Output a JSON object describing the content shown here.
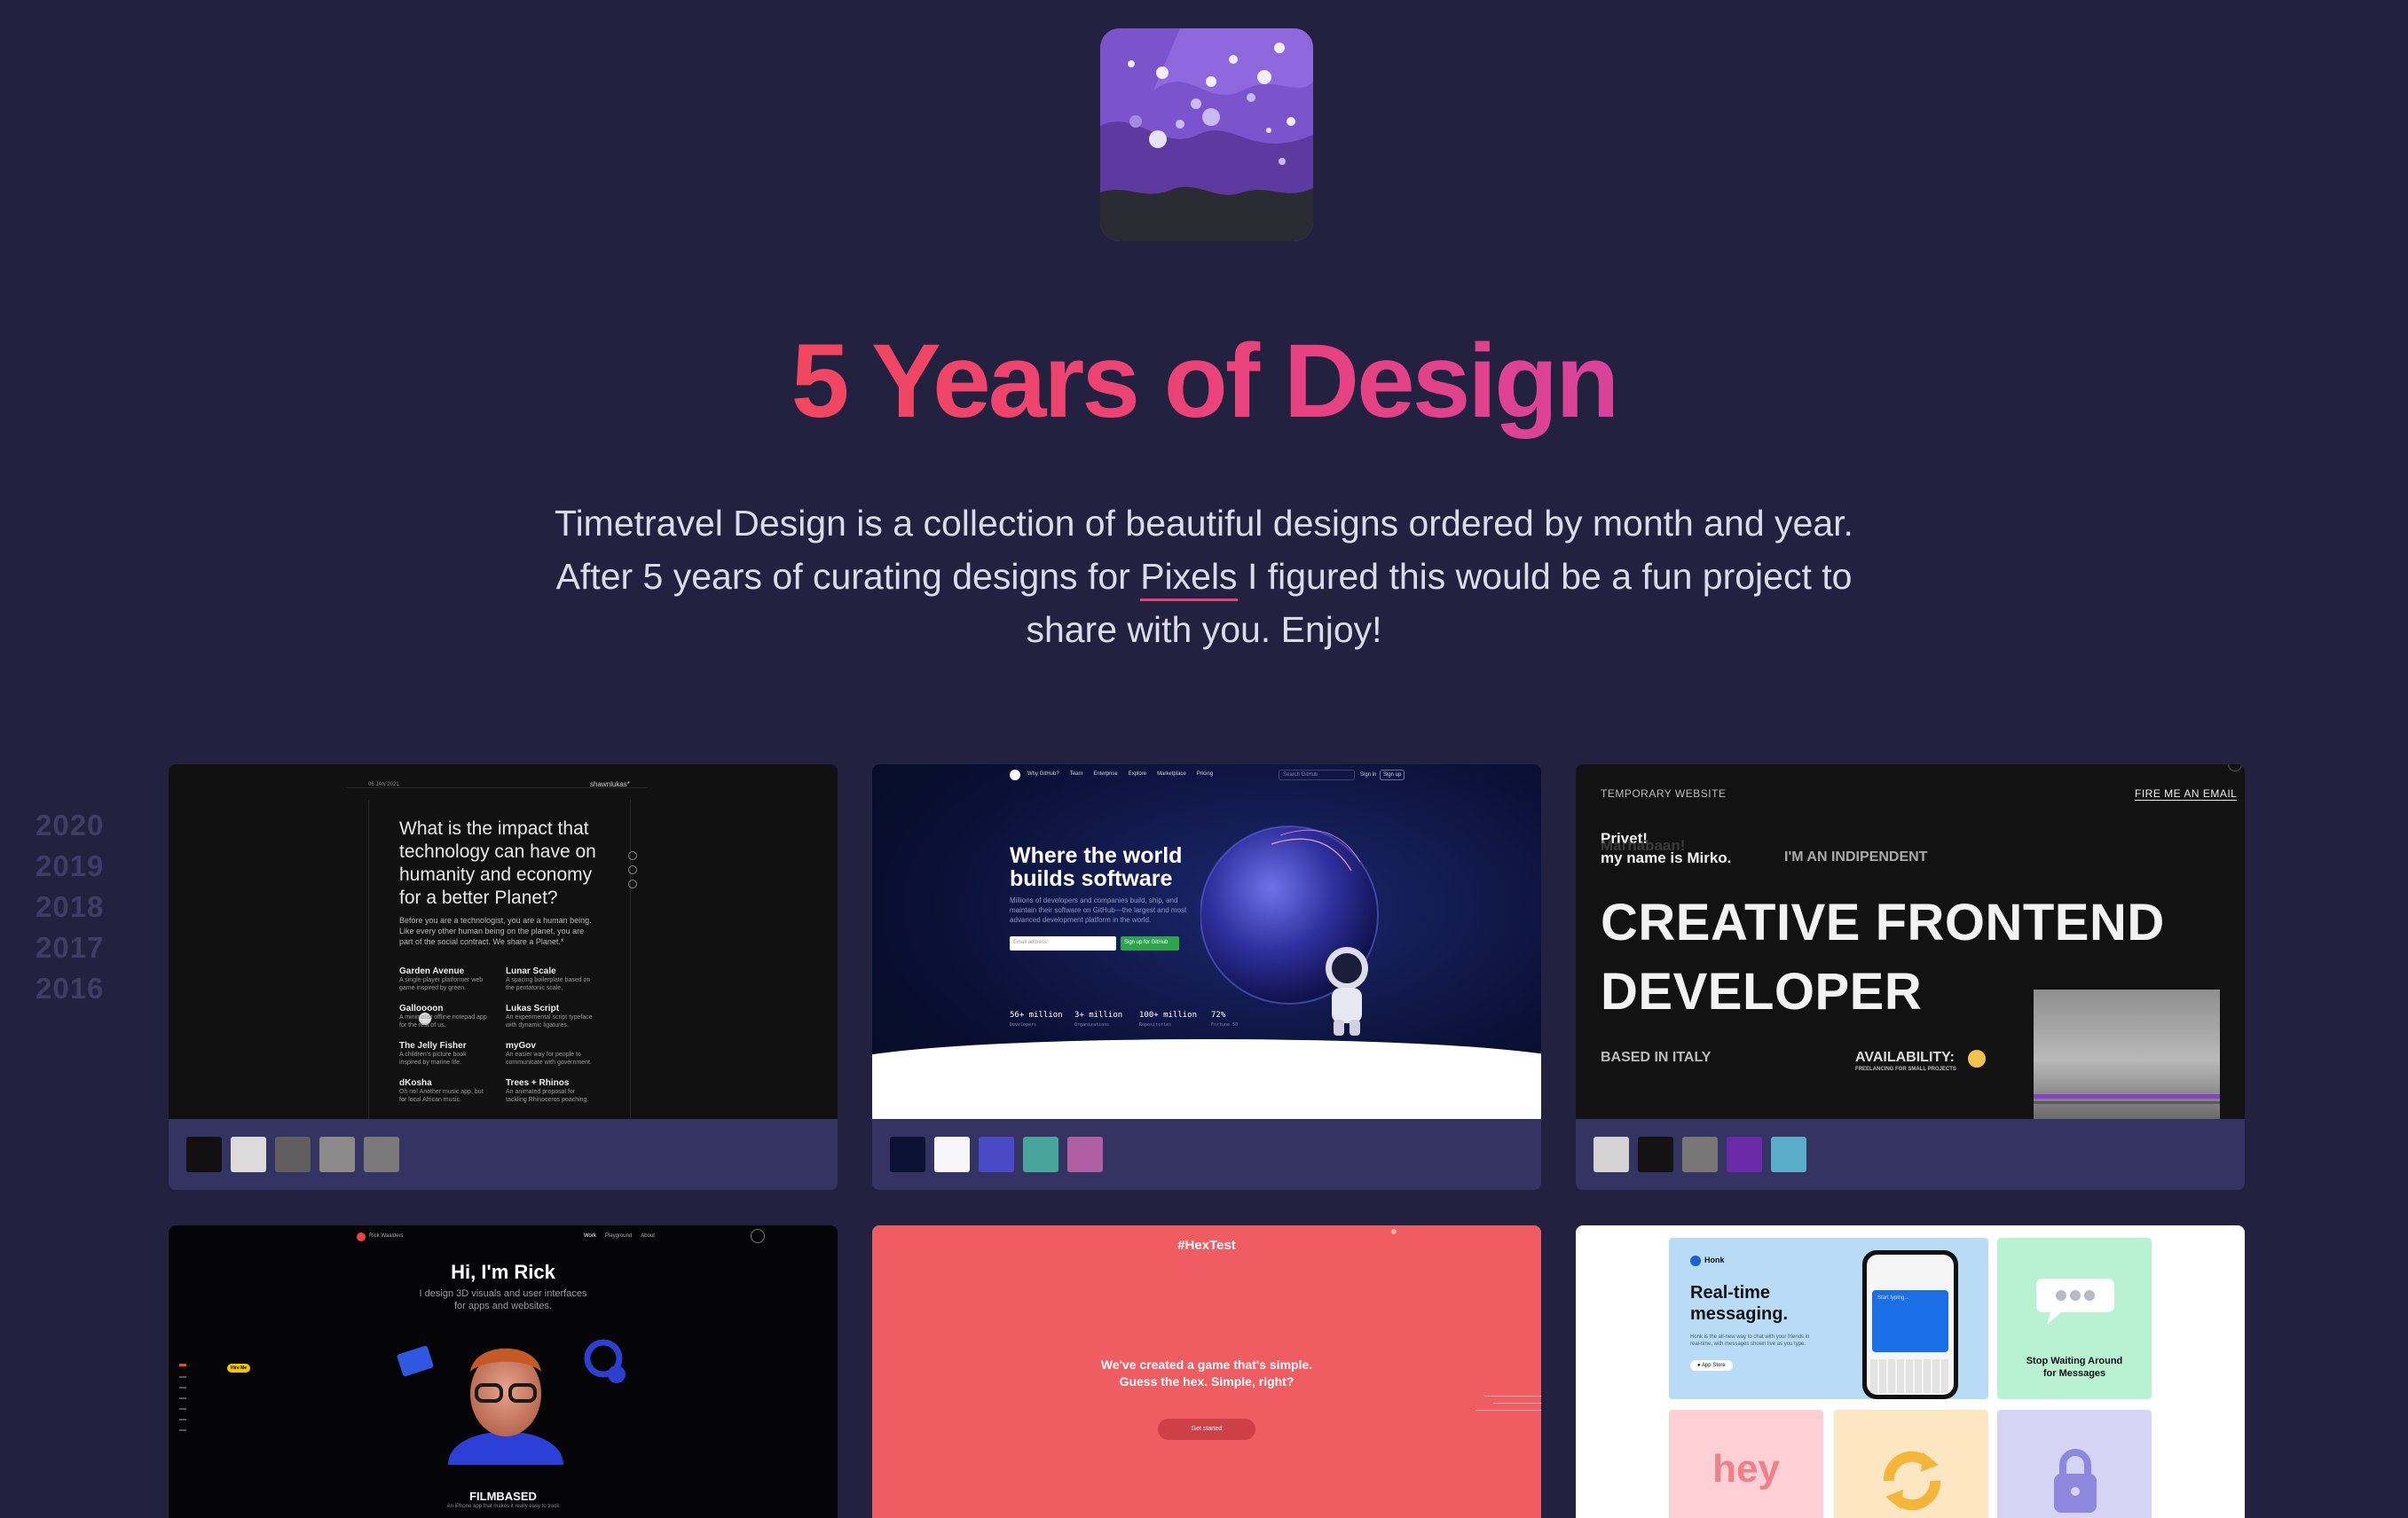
{
  "hero": {
    "title": "5 Years of Design",
    "intro_line1": "Timetravel Design is a collection of beautiful designs ordered by month and year.",
    "intro_line2_before": "After 5 years of curating designs for ",
    "intro_link": "Pixels",
    "intro_line2_after": " I figured this would be a fun project to",
    "intro_line3": "share with you. Enjoy!"
  },
  "years": [
    "2020",
    "2019",
    "2018",
    "2017",
    "2016"
  ],
  "cards": [
    {
      "name": "shawnlukas",
      "top_left": "06 JAN 2021",
      "top_right": "shawnlukas*",
      "headline": "What is the impact that technology can have on humanity and economy for a better Planet?",
      "body": "Before you are a technologist, you are a human being. Like every other human being on the planet, you are part of the social contract. We share a Planet.*",
      "projects": [
        {
          "name": "Garden Avenue",
          "desc": "A single-player platformer web game inspired by green."
        },
        {
          "name": "Lunar Scale",
          "desc": "A spacing boilerplate based on the pentatonic scale."
        },
        {
          "name": "Galloooon",
          "desc": "A minimalist offline notepad app for the rest of us."
        },
        {
          "name": "Lukas Script",
          "desc": "An experimental script typeface with dynamic ligatures."
        },
        {
          "name": "The Jelly Fisher",
          "desc": "A children's picture book inspired by marine life."
        },
        {
          "name": "myGov",
          "desc": "An easier way for people to communicate with government."
        },
        {
          "name": "dKosha",
          "desc": "Oh no! Another music app, but for local African music."
        },
        {
          "name": "Trees + Rhinos",
          "desc": "An animated proposal for tackling Rhinoceros poaching."
        }
      ],
      "palette": [
        "#111111",
        "#dcdcdc",
        "#5f5f5f",
        "#8a8a8a",
        "#7a7a7a"
      ]
    },
    {
      "name": "github",
      "nav": [
        "Why GitHub?",
        "Team",
        "Enterprise",
        "Explore",
        "Marketplace",
        "Pricing"
      ],
      "search_placeholder": "Search GitHub",
      "signin": "Sign in",
      "signup": "Sign up",
      "headline_1": "Where the world",
      "headline_2": "builds software",
      "body": "Millions of developers and companies build, ship, and maintain their software on GitHub—the largest and most advanced development platform in the world.",
      "email_placeholder": "Email address",
      "cta": "Sign up for GitHub",
      "stats": [
        {
          "value": "56+ million",
          "label": "Developers"
        },
        {
          "value": "3+ million",
          "label": "Organizations"
        },
        {
          "value": "100+ million",
          "label": "Repositories"
        },
        {
          "value": "72%",
          "label": "Fortune 50"
        }
      ],
      "palette": [
        "#0c1233",
        "#f6f6f8",
        "#4a49c6",
        "#49a59c",
        "#b05fa5"
      ]
    },
    {
      "name": "mirko",
      "top_left": "TEMPORARY WEBSITE",
      "top_right": "FIRE ME AN EMAIL",
      "greet": "Privet!",
      "greet_ghost": "Marhabaan!",
      "intro": "my name is Mirko.",
      "indep": "I'M AN INDIPENDENT",
      "big_1": "CREATIVE FRONTEND",
      "big_2": "DEVELOPER",
      "based": "BASED IN ITALY",
      "avail": "AVAILABILITY:",
      "avail_sub": "FREELANCING FOR SMALL PROJECTS",
      "palette": [
        "#d4d4d4",
        "#131313",
        "#777777",
        "#6b2aa8",
        "#5aaec9"
      ]
    },
    {
      "name": "rick",
      "brand": "Rick Waalders",
      "nav": [
        "Work",
        "Playground",
        "About"
      ],
      "headline": "Hi, I'm Rick",
      "sub_1": "I design 3D visuals and user interfaces",
      "sub_2": "for apps and websites.",
      "tag": "Hire Me",
      "project": "FILMBASED",
      "project_desc": "An iPhone app that makes it really easy to track"
    },
    {
      "name": "hextest",
      "brand": "HexTest",
      "line_1": "We've created a game that's simple.",
      "line_2": "Guess the hex. Simple, right?",
      "cta": "Get started"
    },
    {
      "name": "honk",
      "brand": "Honk",
      "headline_1": "Real-time",
      "headline_2": "messaging.",
      "body": "Honk is the all-new way to chat with your friends in real-time, with messages shown live as you type.",
      "store": "App Store",
      "phone_placeholder": "Start typing...",
      "side_1": "Stop Waiting Around",
      "side_2": "for Messages",
      "tile_hey": "hey"
    }
  ]
}
